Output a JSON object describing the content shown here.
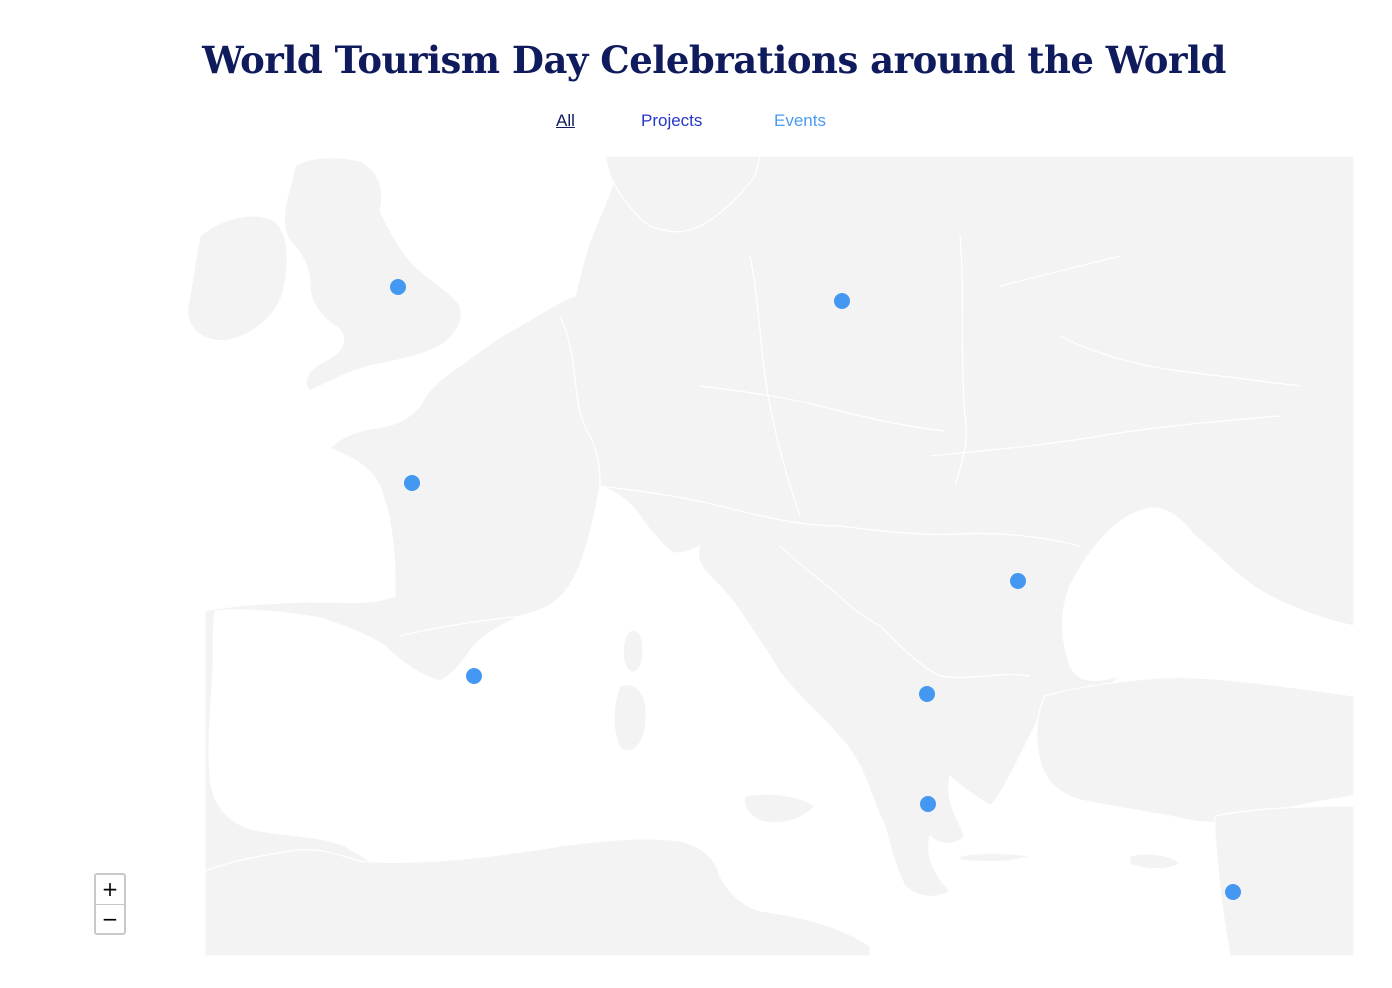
{
  "header": {
    "title": "World Tourism Day Celebrations around the World"
  },
  "filters": {
    "all": "All",
    "projects": "Projects",
    "events": "Events"
  },
  "colors": {
    "land": "#f3f3f3",
    "border": "#ffffff",
    "marker": "#4598f2",
    "title": "#0f1b5c",
    "projects": "#2436c8",
    "events": "#4a9bf0"
  },
  "map": {
    "region": "Europe and Mediterranean",
    "markers": [
      {
        "id": "uk"
      },
      {
        "id": "poland"
      },
      {
        "id": "west-france"
      },
      {
        "id": "south-france"
      },
      {
        "id": "romania"
      },
      {
        "id": "north-macedonia"
      },
      {
        "id": "greece"
      },
      {
        "id": "lebanon"
      }
    ]
  },
  "zoom": {
    "in_label": "+",
    "out_label": "−"
  }
}
